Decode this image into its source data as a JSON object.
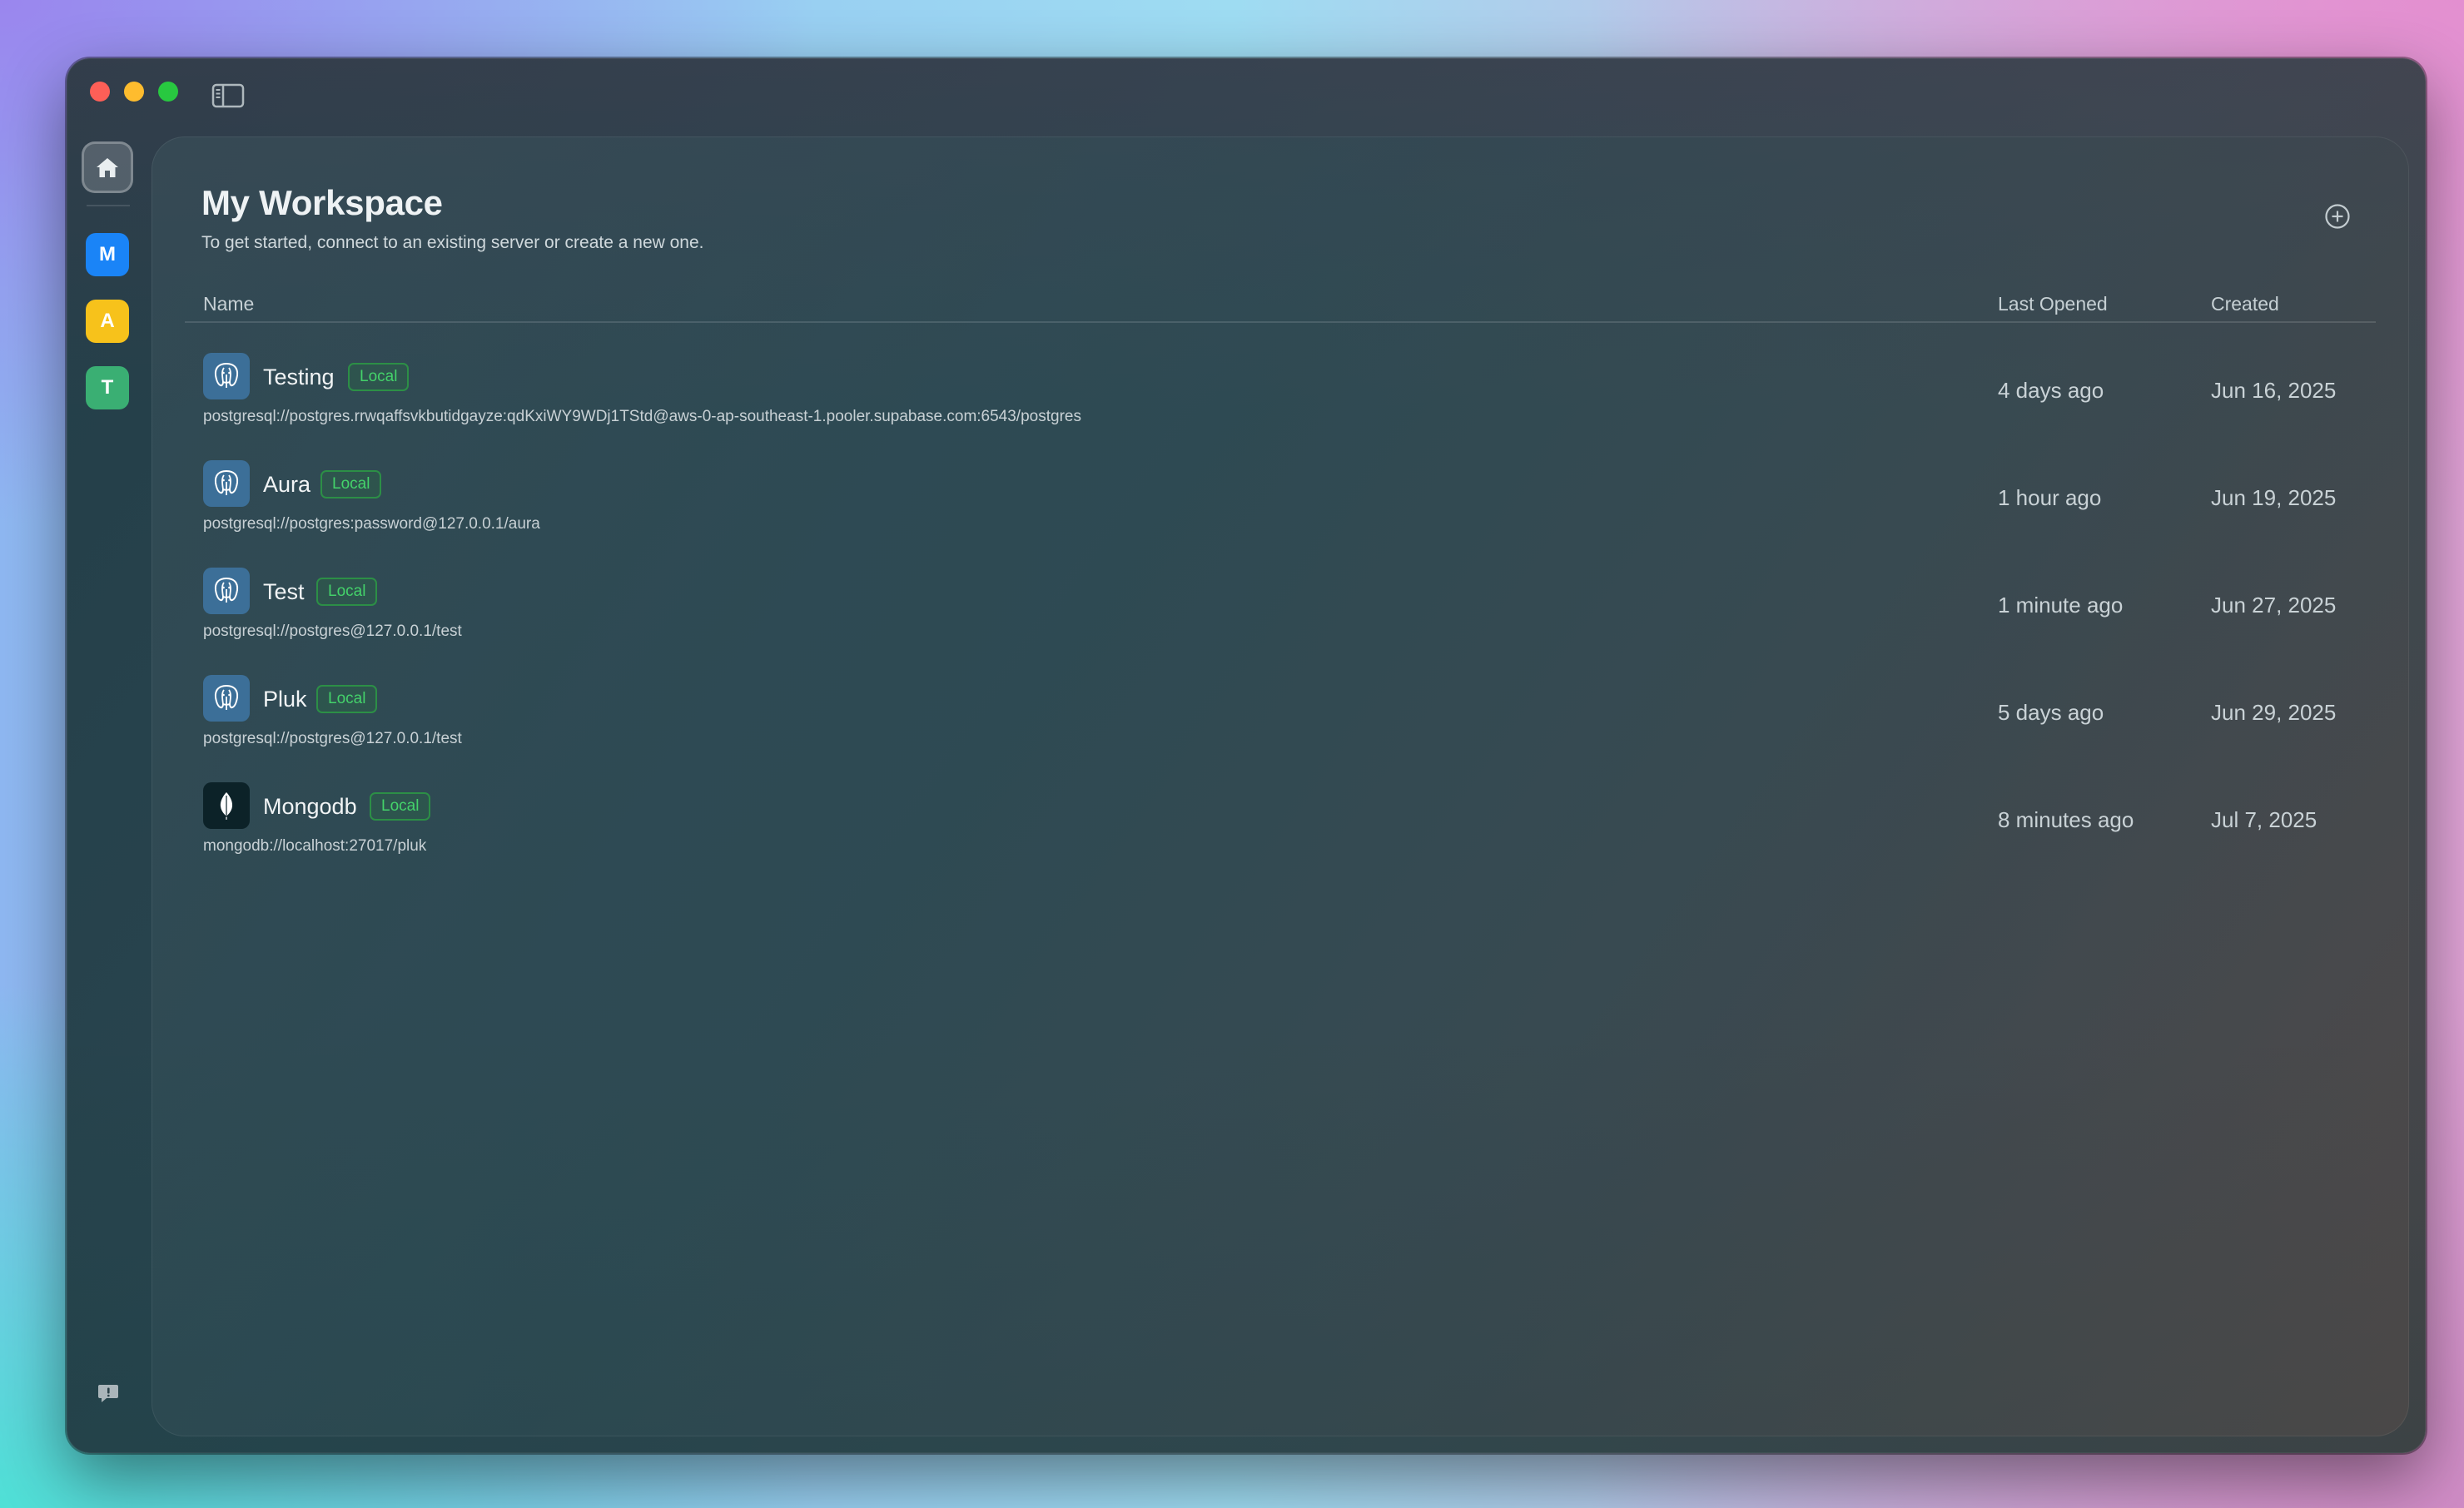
{
  "window": {
    "traffic_lights": {
      "close": "#fe5f57",
      "minimize": "#febc2e",
      "maximize": "#28c840"
    }
  },
  "rail": {
    "home_icon": "home-icon",
    "workspaces": [
      {
        "letter": "M",
        "color": "#1a84f7"
      },
      {
        "letter": "A",
        "color": "#f7c21b"
      },
      {
        "letter": "T",
        "color": "#3aaf73"
      }
    ],
    "feedback_icon": "feedback-icon"
  },
  "header": {
    "title": "My Workspace",
    "subtitle": "To get started, connect to an existing server or create a new one.",
    "add_icon": "plus-circle-icon"
  },
  "table": {
    "columns": {
      "name": "Name",
      "last_opened": "Last Opened",
      "created": "Created"
    },
    "rows": [
      {
        "name": "Testing",
        "badge": "Local",
        "icon": "postgresql-icon",
        "url": "postgresql://postgres.rrwqaffsvkbutidgayze:qdKxiWY9WDj1TStd@aws-0-ap-southeast-1.pooler.supabase.com:6543/postgres",
        "last_opened": "4 days ago",
        "created": "Jun 16, 2025"
      },
      {
        "name": "Aura",
        "badge": "Local",
        "icon": "postgresql-icon",
        "url": "postgresql://postgres:password@127.0.0.1/aura",
        "last_opened": "1 hour ago",
        "created": "Jun 19, 2025"
      },
      {
        "name": "Test",
        "badge": "Local",
        "icon": "postgresql-icon",
        "url": "postgresql://postgres@127.0.0.1/test",
        "last_opened": "1 minute ago",
        "created": "Jun 27, 2025"
      },
      {
        "name": "Pluk",
        "badge": "Local",
        "icon": "postgresql-icon",
        "url": "postgresql://postgres@127.0.0.1/test",
        "last_opened": "5 days ago",
        "created": "Jun 29, 2025"
      },
      {
        "name": "Mongodb",
        "badge": "Local",
        "icon": "mongodb-icon",
        "url": "mongodb://localhost:27017/pluk",
        "last_opened": "8 minutes ago",
        "created": "Jul 7, 2025"
      }
    ]
  },
  "colors": {
    "badge_text": "#44d26a",
    "badge_border": "#2c8f46",
    "postgres_icon_bg": "#3c6f98",
    "mongodb_icon_bg": "#0c2228"
  }
}
